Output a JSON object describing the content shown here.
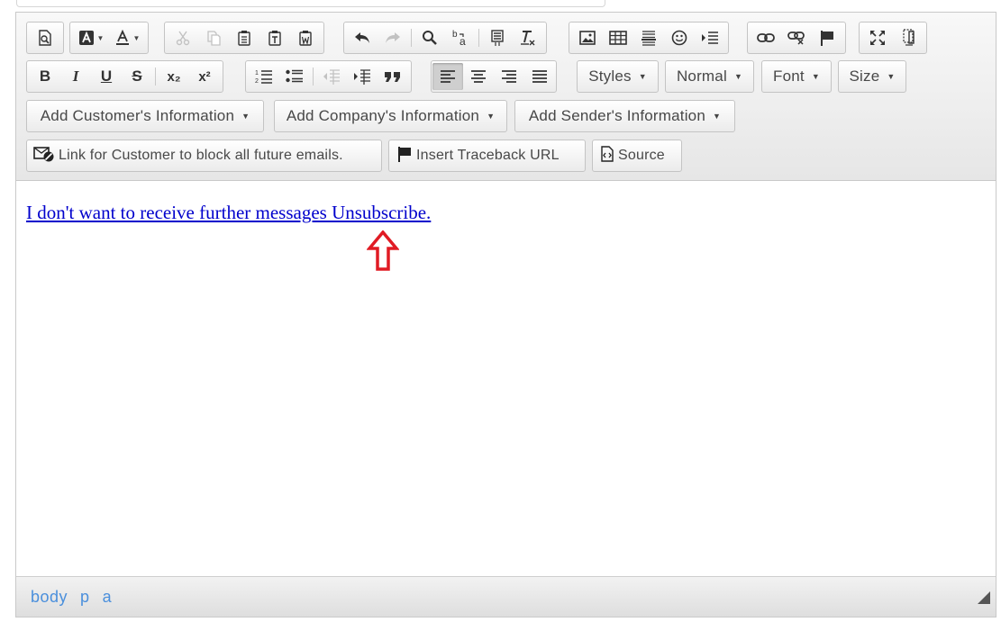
{
  "toolbar": {
    "row1": {
      "doc_buttons": [
        "preview-icon"
      ],
      "color_buttons": [
        "background-color-icon",
        "text-color-icon"
      ],
      "clipboard_buttons": [
        "cut-icon",
        "copy-icon",
        "paste-icon",
        "paste-text-icon",
        "paste-word-icon"
      ],
      "undo_buttons": [
        "undo-icon",
        "redo-icon",
        "find-icon",
        "replace-icon",
        "select-all-icon",
        "remove-format-icon"
      ],
      "insert_buttons": [
        "image-icon",
        "table-icon",
        "horizontal-line-icon",
        "smiley-icon",
        "indent-block-icon"
      ],
      "link_buttons": [
        "link-icon",
        "unlink-icon",
        "anchor-flag-icon"
      ],
      "view_buttons": [
        "maximize-icon",
        "show-blocks-icon"
      ]
    },
    "row2": {
      "bold": "B",
      "italic": "I",
      "underline": "U",
      "strike": "S",
      "subscript": "x₂",
      "superscript": "x²",
      "align_active": "left",
      "styles_label": "Styles",
      "format_label": "Normal",
      "font_label": "Font",
      "size_label": "Size"
    },
    "row3": {
      "customer_info": "Add Customer's Information",
      "company_info": "Add Company's Information",
      "sender_info": "Add Sender's Information"
    },
    "row4": {
      "block_emails": "Link for Customer to block all future emails.",
      "traceback": "Insert Traceback URL",
      "source": "Source"
    }
  },
  "content": {
    "link_text": "I don't want to receive further messages Unsubscribe.",
    "arrow_color": "#e01b24"
  },
  "statusbar": {
    "path": [
      "body",
      "p",
      "a"
    ]
  },
  "colors": {
    "link": "#0000cc",
    "path": "#4a8fdc"
  }
}
